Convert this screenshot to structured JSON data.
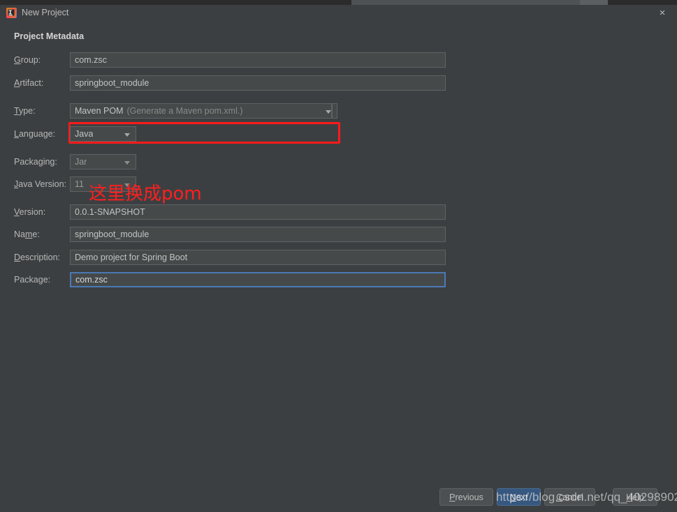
{
  "window": {
    "title": "New Project",
    "app_icon": "intellij-idea-icon",
    "close_label": "×"
  },
  "dialog": {
    "section_title": "Project Metadata"
  },
  "form": {
    "rows": [
      {
        "id": "group",
        "label": "Group:",
        "mnemonic": "G",
        "type": "text",
        "value": "com.zsc",
        "placeholder": ""
      },
      {
        "id": "artifact",
        "label": "Artifact:",
        "mnemonic": "A",
        "type": "text",
        "value": "springboot_module",
        "placeholder": ""
      },
      {
        "id": "type",
        "label": "Type:",
        "mnemonic": "T",
        "type": "combo",
        "value": "Maven POM",
        "hint": "(Generate a Maven pom.xml.)"
      },
      {
        "id": "language",
        "label": "Language:",
        "mnemonic": "L",
        "type": "combo",
        "value": "Java"
      },
      {
        "id": "packaging",
        "label": "Packaging:",
        "mnemonic": "",
        "type": "combo",
        "value": "Jar"
      },
      {
        "id": "java-version",
        "label": "Java Version:",
        "mnemonic": "J",
        "type": "combo",
        "value": "11"
      },
      {
        "id": "version",
        "label": "Version:",
        "mnemonic": "V",
        "type": "text",
        "value": "0.0.1-SNAPSHOT",
        "placeholder": ""
      },
      {
        "id": "name",
        "label": "Name:",
        "mnemonic": "m",
        "type": "text",
        "value": "springboot_module",
        "placeholder": ""
      },
      {
        "id": "description",
        "label": "Description:",
        "mnemonic": "D",
        "type": "text",
        "value": "Demo project for Spring Boot",
        "placeholder": ""
      },
      {
        "id": "package",
        "label": "Package:",
        "mnemonic": "",
        "type": "text",
        "value": "com.zsc",
        "placeholder": "",
        "focused": true
      }
    ]
  },
  "annotations": {
    "highlight_target": "type-combo",
    "note_text": "这里换成pom",
    "color": "#ff1f1f"
  },
  "footer": {
    "buttons": [
      {
        "id": "previous",
        "label": "Previous",
        "mnemonic": "P",
        "default": false
      },
      {
        "id": "next",
        "label": "Next",
        "mnemonic": "N",
        "default": true
      },
      {
        "id": "cancel",
        "label": "Cancel",
        "mnemonic": "C",
        "default": false
      },
      {
        "id": "help",
        "label": "Help",
        "mnemonic": "H",
        "default": false
      }
    ]
  },
  "watermark": {
    "text": "https://blog.csdn.net/qq_40298902"
  }
}
